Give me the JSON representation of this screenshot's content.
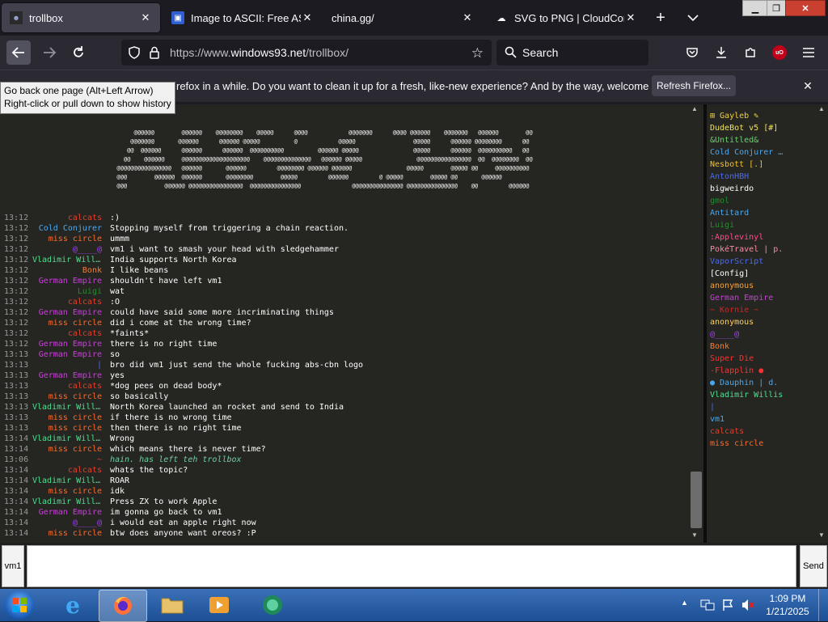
{
  "browser": {
    "tabs": [
      {
        "title": "trollbox",
        "icon": "trollbox-favicon",
        "active": true
      },
      {
        "title": "Image to ASCII: Free ASCII",
        "icon": "page-favicon",
        "active": false
      },
      {
        "title": "china.gg/",
        "icon": "",
        "active": false
      },
      {
        "title": "SVG to PNG | CloudConvert",
        "icon": "cloud-favicon",
        "active": false
      }
    ],
    "new_tab": "+",
    "tab_list": "⌄",
    "url": "https://www.windows93.net/trollbox/",
    "url_host": "windows93.net",
    "url_prefix": "https://www.",
    "url_suffix": "/trollbox/",
    "search_placeholder": "Search",
    "notification": "refox in a while. Do you want to clean it up for a fresh, like-new experience? And by the way, welcome back!",
    "refresh_button": "Refresh Firefox...",
    "tooltip_line1": "Go back one page (Alt+Left Arrow)",
    "tooltip_line2": "Right-click or pull down to show history",
    "ublock_label": "uO"
  },
  "ascii_art": [
    "       @@@@@@        @@@@@@    @@@@@@@@    @@@@@      @@@@            @@@@@@@      @@@@ @@@@@@    @@@@@@@   @@@@@@        @@",
    "      @@@@@@@       @@@@@@      @@@@@@ @@@@@          @            @@@@@                 @@@@@      @@@@@@ @@@@@@@@      @@",
    "     @@  @@@@@@      @@@@@@      @@@@@@  @@@@@@@@@@          @@@@@@ @@@@@                @@@@@      @@@@@@  @@@@@@@@@@   @@",
    "    @@    @@@@@@     @@@@@@@@@@@@@@@@@@@@    @@@@@@@@@@@@@@   @@@@@@ @@@@@                @@@@@@@@@@@@@@@@  @@  @@@@@@@@  @@",
    "  @@@@@@@@@@@@@@@@   @@@@@@       @@@@@@         @@@@@@@@ @@@@@@ @@@@@@                @@@@@        @@@@@ @@     @@@@@@@@@@",
    "  @@@        @@@@@@  @@@@@@       @@@@@@@@        @@@@@         @@@@@@         @ @@@@@        @@@@@ @@       @@@@@@",
    "  @@@           @@@@@@ @@@@@@@@@@@@@@@@  @@@@@@@@@@@@@@@               @@@@@@@@@@@@@@@ @@@@@@@@@@@@@@@    @@         @@@@@@"
  ],
  "messages": [
    {
      "time": "13:12",
      "name": "calcats",
      "color": "#e0402a",
      "text": ":)"
    },
    {
      "time": "13:12",
      "name": "Cold Conjurer",
      "color": "#4aa8f0",
      "text": "Stopping myself from triggering a chain reaction."
    },
    {
      "time": "13:12",
      "name": "miss circle",
      "color": "#ff6a2a",
      "text": "ummm"
    },
    {
      "time": "13:12",
      "name": "@____@",
      "color": "#a045e8",
      "text": "vm1 i want to smash your head with sledgehammer"
    },
    {
      "time": "13:12",
      "name": "Vladimir Willis",
      "color": "#4ce08e",
      "text": "India supports North Korea"
    },
    {
      "time": "13:12",
      "name": "Bonk",
      "color": "#ff7a2a",
      "text": "I like beans"
    },
    {
      "time": "13:12",
      "name": "German Empire",
      "color": "#c840d8",
      "text": "shouldn't have left vm1"
    },
    {
      "time": "13:12",
      "name": "Luigi",
      "color": "#1f8f2a",
      "text": "wat"
    },
    {
      "time": "13:12",
      "name": "calcats",
      "color": "#e0402a",
      "text": ":O"
    },
    {
      "time": "13:12",
      "name": "German Empire",
      "color": "#c840d8",
      "text": "could have said some more incriminating things"
    },
    {
      "time": "13:12",
      "name": "miss circle",
      "color": "#ff6a2a",
      "text": "did i come at the wrong time?"
    },
    {
      "time": "13:12",
      "name": "calcats",
      "color": "#e0402a",
      "text": "*faints*"
    },
    {
      "time": "13:12",
      "name": "German Empire",
      "color": "#c840d8",
      "text": "there is no right time"
    },
    {
      "time": "13:13",
      "name": "German Empire",
      "color": "#c840d8",
      "text": "so"
    },
    {
      "time": "13:13",
      "name": "|",
      "color": "#4a6af0",
      "text": "bro did vm1 just send the whole fucking abs-cbn logo"
    },
    {
      "time": "13:13",
      "name": "German Empire",
      "color": "#c840d8",
      "text": "yes"
    },
    {
      "time": "13:13",
      "name": "calcats",
      "color": "#e0402a",
      "text": "*dog pees on dead body*"
    },
    {
      "time": "13:13",
      "name": "miss circle",
      "color": "#ff6a2a",
      "text": "so basically"
    },
    {
      "time": "13:13",
      "name": "Vladimir Willis",
      "color": "#4ce08e",
      "text": "North Korea launched an rocket and send to India"
    },
    {
      "time": "13:13",
      "name": "miss circle",
      "color": "#ff6a2a",
      "text": "if there is no wrong time"
    },
    {
      "time": "13:13",
      "name": "miss circle",
      "color": "#ff6a2a",
      "text": "then there is no right time"
    },
    {
      "time": "13:14",
      "name": "Vladimir Willis",
      "color": "#4ce08e",
      "text": "Wrong"
    },
    {
      "time": "13:14",
      "name": "miss circle",
      "color": "#ff6a2a",
      "text": "which means there is never time?"
    },
    {
      "time": "13:06",
      "name": "~",
      "color": "#e0402a",
      "text": "hain. has left teh trollbox",
      "system": true
    },
    {
      "time": "13:14",
      "name": "calcats",
      "color": "#e0402a",
      "text": "whats the topic?"
    },
    {
      "time": "13:14",
      "name": "Vladimir Willis",
      "color": "#4ce08e",
      "text": "ROAR"
    },
    {
      "time": "13:14",
      "name": "miss circle",
      "color": "#ff6a2a",
      "text": "idk"
    },
    {
      "time": "13:14",
      "name": "Vladimir Willis",
      "color": "#4ce08e",
      "text": "Press ZX to work Apple"
    },
    {
      "time": "13:14",
      "name": "German Empire",
      "color": "#c840d8",
      "text": "im gonna go back to vm1"
    },
    {
      "time": "13:14",
      "name": "@____@",
      "color": "#a045e8",
      "text": "i would eat an apple right now"
    },
    {
      "time": "13:14",
      "name": "miss circle",
      "color": "#ff6a2a",
      "text": "btw does anyone want oreos? :P"
    }
  ],
  "users": [
    {
      "name": "⊞ Gayleb ✎",
      "color": "#f0d040"
    },
    {
      "name": "DudeBot v5 [#]",
      "color": "#f0e060"
    },
    {
      "name": "&Untitled&",
      "color": "#6cd070"
    },
    {
      "name": "Cold Conjurer …",
      "color": "#4aa8f0"
    },
    {
      "name": "Nesbott [.]",
      "color": "#f0c030"
    },
    {
      "name": "AntonHBH",
      "color": "#4a6af0"
    },
    {
      "name": "bigweirdo",
      "color": "#ffffff"
    },
    {
      "name": "gmol",
      "color": "#1f8f2a"
    },
    {
      "name": "Antitard",
      "color": "#4aa8f0"
    },
    {
      "name": "Luigi",
      "color": "#1f8f2a"
    },
    {
      "name": ":Applevinyl",
      "color": "#ff4a8a"
    },
    {
      "name": "PokéTravel | p.",
      "color": "#ff8aa0"
    },
    {
      "name": "VaporScript",
      "color": "#4a6af0"
    },
    {
      "name": "[Config]",
      "color": "#ffffff"
    },
    {
      "name": "anonymous",
      "color": "#ffa030"
    },
    {
      "name": "German Empire",
      "color": "#c840d8"
    },
    {
      "name": "~ Kornie ~",
      "color": "#d82020"
    },
    {
      "name": "anonymous",
      "color": "#ffd060"
    },
    {
      "name": "@____@",
      "color": "#a045e8"
    },
    {
      "name": "Bonk",
      "color": "#ff7a2a"
    },
    {
      "name": "Super Die",
      "color": "#ff3030"
    },
    {
      "name": "-Flapplin ●",
      "color": "#ff3030"
    },
    {
      "name": "● Dauphin | d.",
      "color": "#4aa8f0"
    },
    {
      "name": "Vladimir Willis",
      "color": "#4ce08e"
    },
    {
      "name": "|",
      "color": "#4a6af0"
    },
    {
      "name": "vm1",
      "color": "#4aa8f0"
    },
    {
      "name": "calcats",
      "color": "#e0402a"
    },
    {
      "name": "miss circle",
      "color": "#ff6a2a"
    }
  ],
  "input": {
    "nick": "vm1",
    "value": "",
    "send_label": "Send"
  },
  "taskbar": {
    "apps": [
      "internet-explorer",
      "firefox",
      "file-explorer",
      "media-player",
      "edge-app"
    ],
    "time": "1:09 PM",
    "date": "1/21/2025"
  },
  "colors": {
    "chat_bg": "#252622",
    "firefox_dark": "#1c1b22",
    "firefox_toolbar": "#2b2a33",
    "taskbar": "#2a5ea6"
  }
}
